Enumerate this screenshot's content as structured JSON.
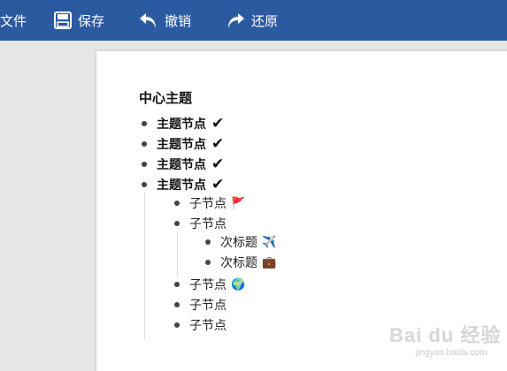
{
  "toolbar": {
    "file_label": "文件",
    "save_label": "保存",
    "undo_label": "撤销",
    "redo_label": "还原"
  },
  "outline": {
    "root_title": "中心主题",
    "check_mark": "✔",
    "main_nodes": [
      {
        "label": "主题节点"
      },
      {
        "label": "主题节点"
      },
      {
        "label": "主题节点"
      },
      {
        "label": "主题节点"
      }
    ],
    "child_nodes": [
      {
        "label": "子节点",
        "emoji": "🚩"
      },
      {
        "label": "子节点"
      },
      {
        "label": "子节点",
        "emoji": "🌍"
      },
      {
        "label": "子节点"
      },
      {
        "label": "子节点"
      }
    ],
    "sub_nodes": [
      {
        "label": "次标题",
        "emoji": "✈️"
      },
      {
        "label": "次标题",
        "emoji": "💼"
      }
    ]
  },
  "watermark": {
    "brand": "Bai du 经验",
    "url": "jingyan.baidu.com"
  },
  "colors": {
    "toolbar_bg": "#2c5aa0",
    "canvas_bg": "#e6e6e6",
    "paper_bg": "#ffffff"
  }
}
